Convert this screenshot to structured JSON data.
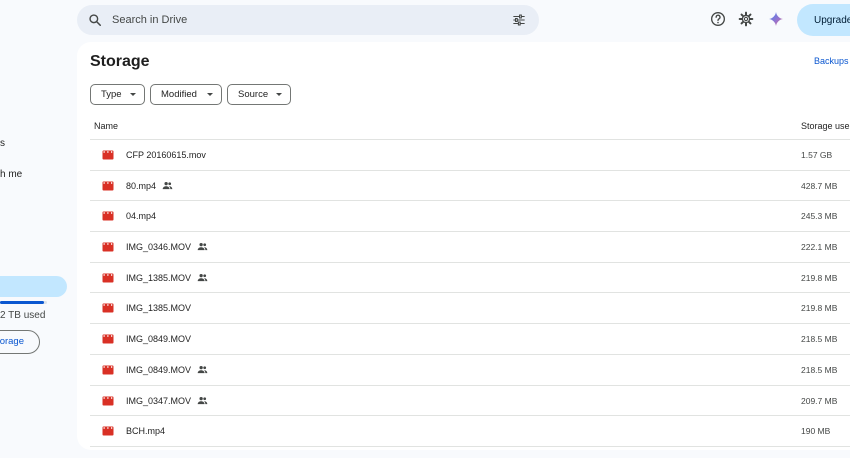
{
  "sidebar": {
    "items": [
      {
        "label": "s"
      },
      {
        "label": "h me"
      }
    ],
    "storage_fraction": 0.93,
    "storage_used_label": "2 TB used",
    "get_storage_label": "orage"
  },
  "search": {
    "placeholder": "Search in Drive",
    "icon": "search-icon",
    "options_icon": "tune-icon"
  },
  "header": {
    "icons": [
      "help-icon",
      "settings-icon",
      "gemini-sparkle-icon"
    ],
    "upgrade_label": "Upgrade"
  },
  "main": {
    "title": "Storage",
    "backups_label": "Backups",
    "filters": [
      {
        "label": "Type"
      },
      {
        "label": "Modified"
      },
      {
        "label": "Source"
      }
    ],
    "columns": {
      "name": "Name",
      "storage": "Storage use"
    },
    "files": [
      {
        "name": "CFP 20160615.mov",
        "shared": false,
        "size": "1.57 GB"
      },
      {
        "name": "80.mp4",
        "shared": true,
        "size": "428.7 MB"
      },
      {
        "name": "04.mp4",
        "shared": false,
        "size": "245.3 MB"
      },
      {
        "name": "IMG_0346.MOV",
        "shared": true,
        "size": "222.1 MB"
      },
      {
        "name": "IMG_1385.MOV",
        "shared": true,
        "size": "219.8 MB"
      },
      {
        "name": "IMG_1385.MOV",
        "shared": false,
        "size": "219.8 MB"
      },
      {
        "name": "IMG_0849.MOV",
        "shared": false,
        "size": "218.5 MB"
      },
      {
        "name": "IMG_0849.MOV",
        "shared": true,
        "size": "218.5 MB"
      },
      {
        "name": "IMG_0347.MOV",
        "shared": true,
        "size": "209.7 MB"
      },
      {
        "name": "BCH.mp4",
        "shared": false,
        "size": "190 MB"
      }
    ]
  },
  "colors": {
    "accent": "#0b57d0",
    "selected": "#c2e7ff",
    "video_icon": "#d93025",
    "background": "#f8fafd"
  }
}
